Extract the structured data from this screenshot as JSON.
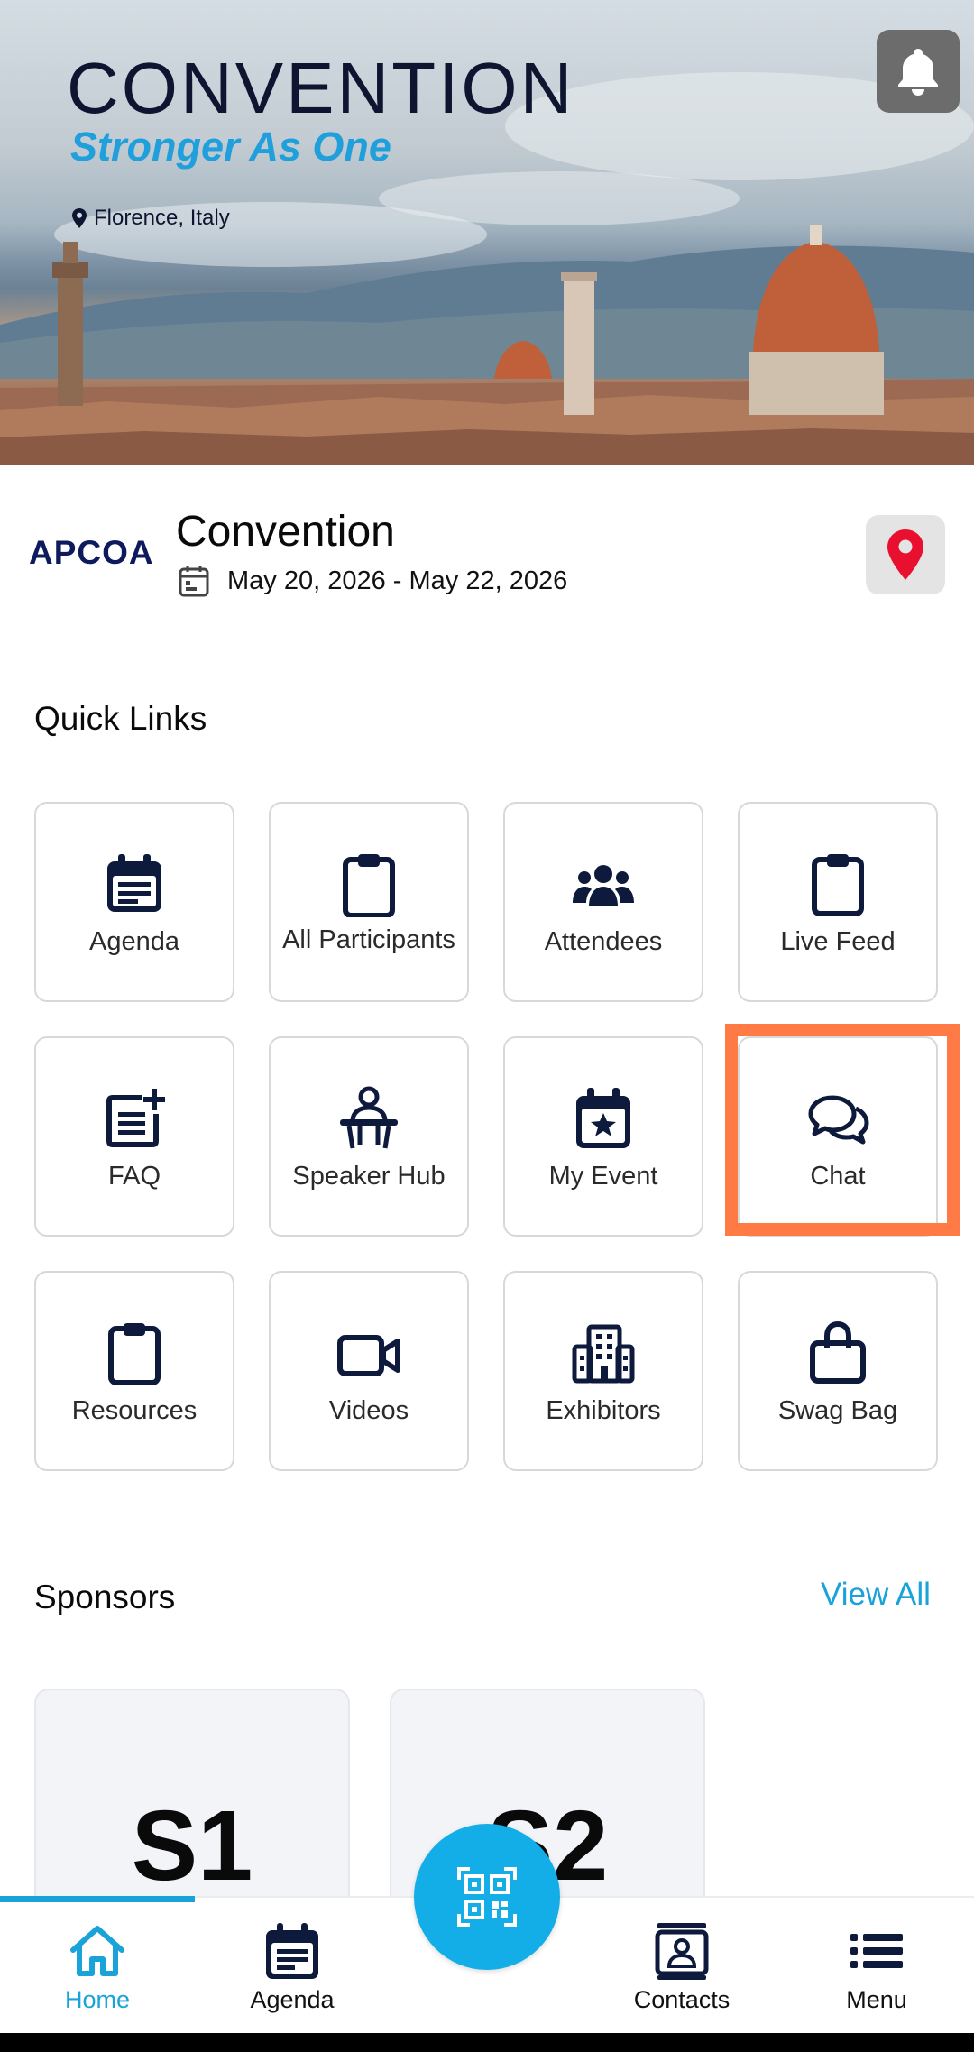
{
  "hero": {
    "title": "CONVENTION",
    "tagline": "Stronger As One",
    "location": "Florence, Italy",
    "notification_icon": "bell-icon"
  },
  "event": {
    "logo_text": "APCOA",
    "name": "Convention",
    "dates": "May 20, 2026 - May 22, 2026",
    "date_icon": "calendar-icon",
    "map_icon": "map-pin-icon"
  },
  "quick_links": {
    "title": "Quick Links",
    "items": [
      {
        "label": "Agenda",
        "icon": "calendar-icon"
      },
      {
        "label": "All Participants",
        "icon": "clipboard-icon"
      },
      {
        "label": "Attendees",
        "icon": "users-icon"
      },
      {
        "label": "Live Feed",
        "icon": "clipboard-icon"
      },
      {
        "label": "FAQ",
        "icon": "note-add-icon"
      },
      {
        "label": "Speaker Hub",
        "icon": "speaker-podium-icon"
      },
      {
        "label": "My Event",
        "icon": "calendar-star-icon"
      },
      {
        "label": "Chat",
        "icon": "chat-bubbles-icon"
      },
      {
        "label": "Resources",
        "icon": "clipboard-icon"
      },
      {
        "label": "Videos",
        "icon": "video-camera-icon"
      },
      {
        "label": "Exhibitors",
        "icon": "building-icon"
      },
      {
        "label": "Swag Bag",
        "icon": "shopping-bag-icon"
      }
    ]
  },
  "sponsors": {
    "title": "Sponsors",
    "view_all": "View All",
    "items": [
      {
        "label": "S1"
      },
      {
        "label": "S2"
      }
    ]
  },
  "bottom_nav": {
    "items": [
      {
        "label": "Home",
        "icon": "home-icon",
        "active": true
      },
      {
        "label": "Agenda",
        "icon": "calendar-icon",
        "active": false
      },
      {
        "label": "Contacts",
        "icon": "contact-card-icon",
        "active": false
      },
      {
        "label": "Menu",
        "icon": "list-menu-icon",
        "active": false
      }
    ],
    "fab_icon": "qr-code-icon"
  },
  "colors": {
    "accent": "#1aa3d9",
    "navy": "#0d1a3c",
    "highlight": "#ff7a45",
    "map_pin": "#e8102e"
  }
}
